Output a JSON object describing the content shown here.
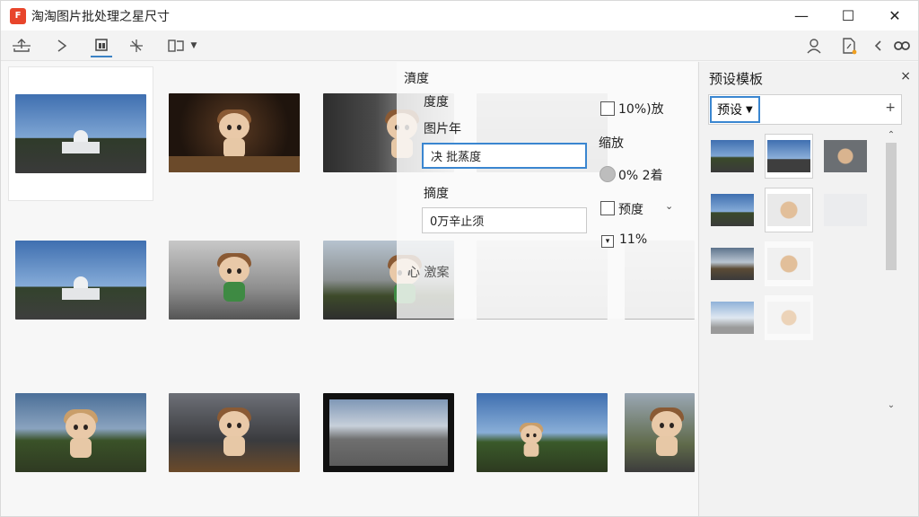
{
  "window": {
    "title": "淘淘图片批处理之星尺寸",
    "app_icon_text": "F",
    "controls": {
      "minimize": "—",
      "maximize": "☐",
      "close": "✕"
    }
  },
  "toolbar": {
    "left_icons": [
      "upload-icon",
      "chevron-right-icon",
      "crop-icon",
      "sparkle-icon",
      "image-icon",
      "dropdown-caret-icon"
    ],
    "right_icons": [
      "user-icon",
      "edit-file-icon",
      "back-icon",
      "link-icon"
    ]
  },
  "settings_panel": {
    "heading": "濆度",
    "label_1": "度度",
    "label_2": "图片年",
    "input_1_value": "决 批蒸度",
    "label_3": "摘度",
    "input_2_value": "0万辛止须",
    "link_text": "心 激案",
    "check_1_label": "10%)放",
    "zoom_label": "缩放",
    "radio_label": "0% 2着",
    "check_2_label": "预度",
    "check_3_label": "11%"
  },
  "right_panel": {
    "title": "预设模板",
    "close": "×",
    "chip_label": "预设",
    "add": "+"
  },
  "colors": {
    "accent": "#3a86d0",
    "app_icon": "#e8452b"
  }
}
